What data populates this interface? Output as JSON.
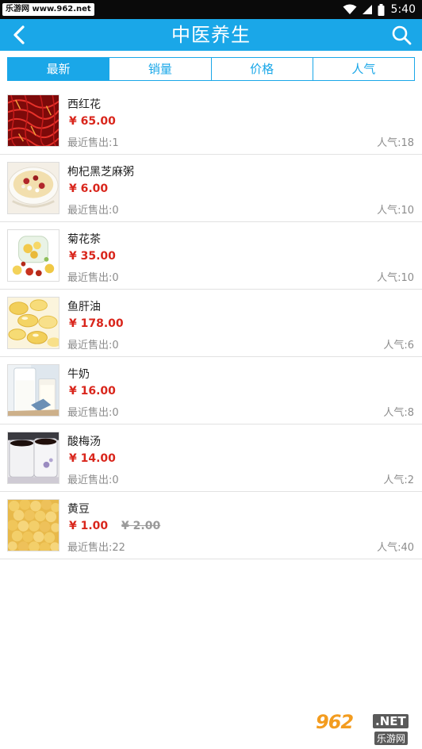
{
  "status_bar": {
    "badge": "乐游网 www.962.net",
    "time": "5:40"
  },
  "header": {
    "title": "中医养生",
    "back_icon": "chevron-left-icon",
    "search_icon": "search-icon"
  },
  "tabs": [
    {
      "label": "最新",
      "active": true
    },
    {
      "label": "销量",
      "active": false
    },
    {
      "label": "价格",
      "active": false
    },
    {
      "label": "人气",
      "active": false
    }
  ],
  "products": [
    {
      "name": "西红花",
      "price": "¥ 65.00",
      "old_price": "",
      "sold": "最近售出:1",
      "popularity": "人气:18"
    },
    {
      "name": "枸杞黑芝麻粥",
      "price": "¥ 6.00",
      "old_price": "",
      "sold": "最近售出:0",
      "popularity": "人气:10"
    },
    {
      "name": "菊花茶",
      "price": "¥ 35.00",
      "old_price": "",
      "sold": "最近售出:0",
      "popularity": "人气:10"
    },
    {
      "name": "鱼肝油",
      "price": "¥ 178.00",
      "old_price": "",
      "sold": "最近售出:0",
      "popularity": "人气:6"
    },
    {
      "name": "牛奶",
      "price": "¥ 16.00",
      "old_price": "",
      "sold": "最近售出:0",
      "popularity": "人气:8"
    },
    {
      "name": "酸梅汤",
      "price": "¥ 14.00",
      "old_price": "",
      "sold": "最近售出:0",
      "popularity": "人气:2"
    },
    {
      "name": "黄豆",
      "price": "¥ 1.00",
      "old_price": "¥ 2.00",
      "sold": "最近售出:22",
      "popularity": "人气:40"
    }
  ],
  "watermark": {
    "logo": "962",
    "net": ".NET",
    "sub": "乐游网"
  },
  "colors": {
    "accent": "#1aa7e8",
    "price": "#d9261c",
    "muted": "#8c8c8c"
  }
}
